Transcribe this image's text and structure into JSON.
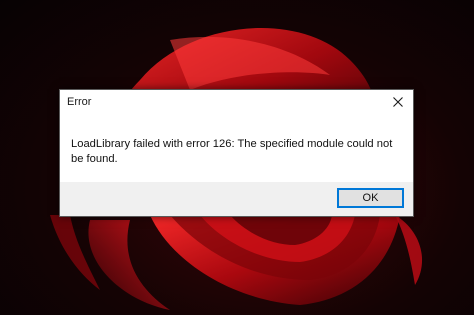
{
  "dialog": {
    "title": "Error",
    "message": "LoadLibrary failed with error 126: The specified module could not be found.",
    "ok_label": "OK",
    "close_icon": "close-icon"
  },
  "wallpaper": {
    "accent_color": "#c0101a",
    "dark_color": "#0b0506"
  }
}
